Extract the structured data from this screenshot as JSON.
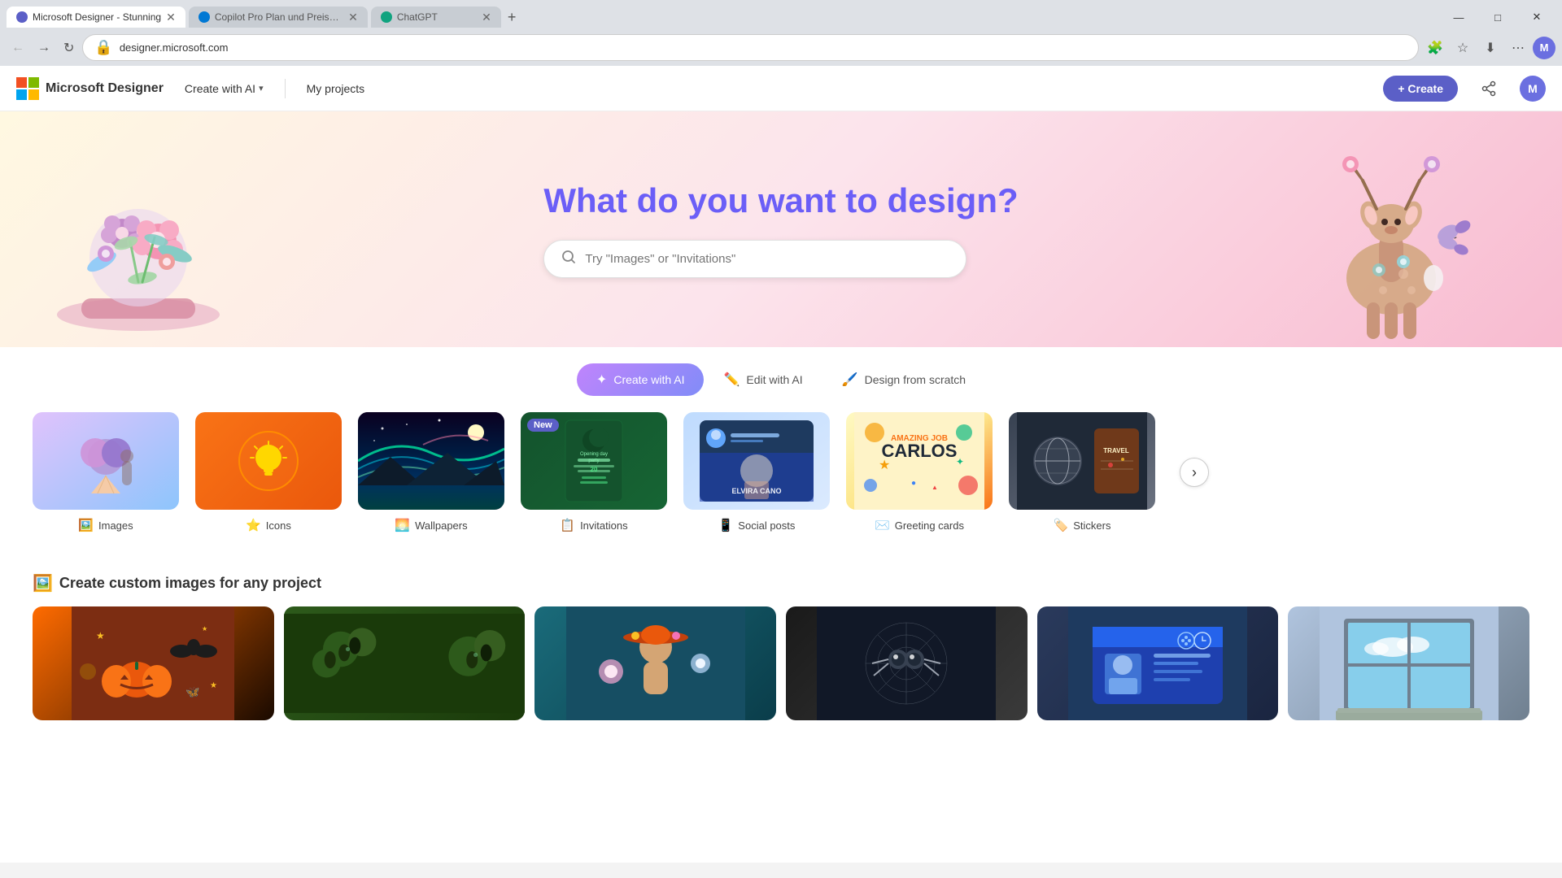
{
  "browser": {
    "tabs": [
      {
        "id": "tab1",
        "title": "Microsoft Designer - Stunning",
        "favicon_color": "#5b5fc7",
        "active": true
      },
      {
        "id": "tab2",
        "title": "Copilot Pro Plan und Preise – F...",
        "favicon_color": "#0078d4",
        "active": false
      },
      {
        "id": "tab3",
        "title": "ChatGPT",
        "favicon_color": "#10a37f",
        "active": false
      }
    ],
    "new_tab_label": "+",
    "address": "designer.microsoft.com",
    "window_controls": {
      "minimize": "—",
      "maximize": "□",
      "close": "✕"
    }
  },
  "nav": {
    "logo_text": "Microsoft Designer",
    "create_with_ai_label": "Create with AI",
    "my_projects_label": "My projects",
    "create_button_label": "+ Create"
  },
  "hero": {
    "title": "What do you want to design?",
    "search_placeholder": "Try \"Images\" or \"Invitations\""
  },
  "tabs": [
    {
      "id": "create-ai",
      "label": "Create with AI",
      "icon": "✦",
      "active": true
    },
    {
      "id": "edit-ai",
      "label": "Edit with AI",
      "icon": "✏️",
      "active": false
    },
    {
      "id": "design-scratch",
      "label": "Design from scratch",
      "icon": "🖌️",
      "active": false
    }
  ],
  "categories": [
    {
      "id": "images",
      "label": "Images",
      "icon": "🖼️"
    },
    {
      "id": "icons",
      "label": "Icons",
      "icon": "⭐"
    },
    {
      "id": "wallpapers",
      "label": "Wallpapers",
      "icon": "🌅"
    },
    {
      "id": "invitations",
      "label": "Invitations",
      "icon": "📋",
      "badge": "New"
    },
    {
      "id": "social-posts",
      "label": "Social posts",
      "icon": "📱"
    },
    {
      "id": "greeting-cards",
      "label": "Greeting cards",
      "icon": "✉️"
    },
    {
      "id": "stickers",
      "label": "Stickers",
      "icon": "🏷️"
    }
  ],
  "custom_images_section": {
    "title": "Create custom images for any project",
    "icon": "🖼️"
  },
  "custom_images": [
    {
      "id": "halloween",
      "type": "halloween"
    },
    {
      "id": "olives",
      "type": "olives"
    },
    {
      "id": "sombrero",
      "type": "sombrero"
    },
    {
      "id": "spider",
      "type": "spider"
    },
    {
      "id": "passport",
      "type": "passport"
    },
    {
      "id": "window",
      "type": "window"
    }
  ]
}
